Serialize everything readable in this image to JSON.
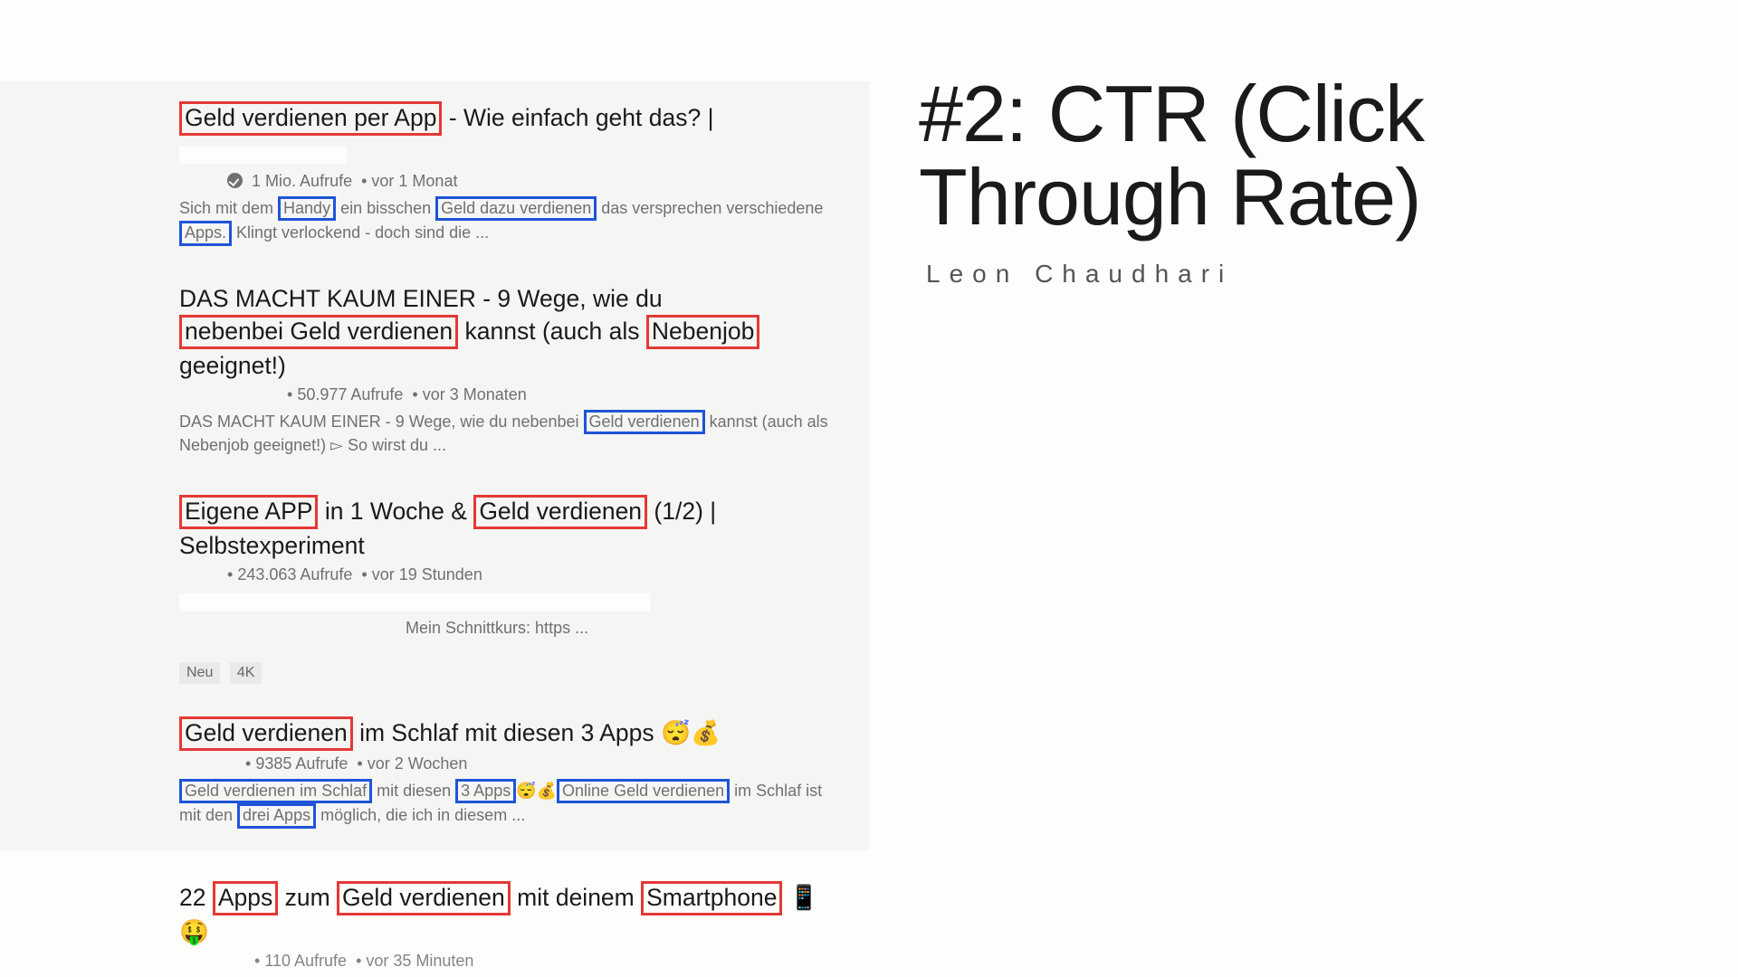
{
  "slide": {
    "headline": "#2: CTR (Click Through Rate)",
    "author": "Leon Chaudhari"
  },
  "results": [
    {
      "title_parts": {
        "p1": "Geld verdienen per App",
        "p2": " - Wie einfach geht das? | "
      },
      "meta": {
        "views": "1 Mio. Aufrufe",
        "age": "vor 1 Monat"
      },
      "desc_parts": {
        "d1": "Sich mit dem ",
        "d2": "Handy",
        "d3": " ein bisschen ",
        "d4": "Geld dazu verdienen",
        "d5": "  das versprechen verschiedene ",
        "d6": "Apps.",
        "d7": " Klingt verlockend - doch sind die ..."
      }
    },
    {
      "title_parts": {
        "p1": "DAS MACHT KAUM EINER - 9 Wege, wie du ",
        "p2": "nebenbei Geld verdienen",
        "p3": " kannst (auch als ",
        "p4": "Nebenjob",
        "p5": " geeignet!)"
      },
      "meta": {
        "views": "50.977 Aufrufe",
        "age": "vor 3 Monaten"
      },
      "desc_parts": {
        "d1": "DAS MACHT KAUM EINER - 9 Wege, wie du nebenbei ",
        "d2": "Geld verdienen",
        "d3": " kannst (auch als Nebenjob geeignet!) ▻ So wirst du ..."
      }
    },
    {
      "title_parts": {
        "p1": "Eigene APP",
        "p2": " in 1 Woche & ",
        "p3": "Geld verdienen",
        "p4": " (1/2) | Selbstexperiment"
      },
      "meta": {
        "views": "243.063 Aufrufe",
        "age": "vor 19 Stunden"
      },
      "desc_parts": {
        "d1": "Mein Schnittkurs: https ..."
      },
      "tags": {
        "t1": "Neu",
        "t2": "4K"
      }
    },
    {
      "title_parts": {
        "p1": "Geld verdienen",
        "p2": " im Schlaf mit diesen 3 Apps 😴💰"
      },
      "meta": {
        "views": "9385 Aufrufe",
        "age": "vor 2 Wochen"
      },
      "desc_parts": {
        "d1": "Geld verdienen im Schlaf",
        "d2": " mit diesen ",
        "d3": "3 Apps",
        "d4": "😴💰",
        "d5": "Online Geld verdienen",
        "d6": " im Schlaf ist mit den ",
        "d7": "drei Apps",
        "d8": " möglich, die ich in diesem ..."
      }
    },
    {
      "title_parts": {
        "p1": "22 ",
        "p2": "Apps",
        "p3": " zum ",
        "p4": "Geld verdienen",
        "p5": " mit deinem ",
        "p6": "Smartphone",
        "p7": " 📱🤑"
      },
      "meta": {
        "views": "110 Aufrufe",
        "age": "vor 35 Minuten"
      }
    }
  ]
}
